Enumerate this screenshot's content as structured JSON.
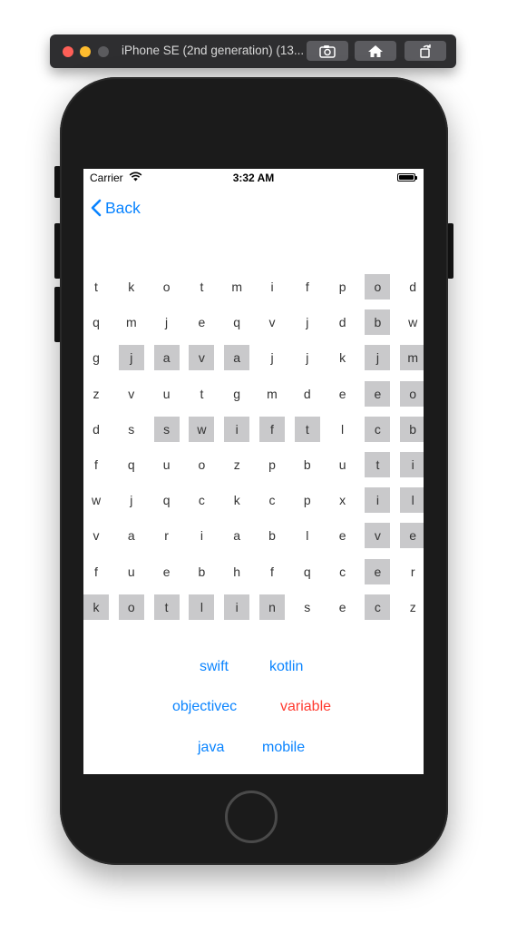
{
  "window": {
    "title": "iPhone SE (2nd generation) (13..."
  },
  "status_bar": {
    "carrier": "Carrier",
    "time": "3:32 AM"
  },
  "nav": {
    "back_label": "Back"
  },
  "grid": [
    [
      [
        "t",
        0
      ],
      [
        "k",
        0
      ],
      [
        "o",
        0
      ],
      [
        "t",
        0
      ],
      [
        "m",
        0
      ],
      [
        "i",
        0
      ],
      [
        "f",
        0
      ],
      [
        "p",
        0
      ],
      [
        "o",
        1
      ],
      [
        "d",
        0
      ]
    ],
    [
      [
        "q",
        0
      ],
      [
        "m",
        0
      ],
      [
        "j",
        0
      ],
      [
        "e",
        0
      ],
      [
        "q",
        0
      ],
      [
        "v",
        0
      ],
      [
        "j",
        0
      ],
      [
        "d",
        0
      ],
      [
        "b",
        1
      ],
      [
        "w",
        0
      ]
    ],
    [
      [
        "g",
        0
      ],
      [
        "j",
        1
      ],
      [
        "a",
        1
      ],
      [
        "v",
        1
      ],
      [
        "a",
        1
      ],
      [
        "j",
        0
      ],
      [
        "j",
        0
      ],
      [
        "k",
        0
      ],
      [
        "j",
        1
      ],
      [
        "m",
        1
      ]
    ],
    [
      [
        "z",
        0
      ],
      [
        "v",
        0
      ],
      [
        "u",
        0
      ],
      [
        "t",
        0
      ],
      [
        "g",
        0
      ],
      [
        "m",
        0
      ],
      [
        "d",
        0
      ],
      [
        "e",
        0
      ],
      [
        "e",
        1
      ],
      [
        "o",
        1
      ]
    ],
    [
      [
        "d",
        0
      ],
      [
        "s",
        0
      ],
      [
        "s",
        1
      ],
      [
        "w",
        1
      ],
      [
        "i",
        1
      ],
      [
        "f",
        1
      ],
      [
        "t",
        1
      ],
      [
        "l",
        0
      ],
      [
        "c",
        1
      ],
      [
        "b",
        1
      ]
    ],
    [
      [
        "f",
        0
      ],
      [
        "q",
        0
      ],
      [
        "u",
        0
      ],
      [
        "o",
        0
      ],
      [
        "z",
        0
      ],
      [
        "p",
        0
      ],
      [
        "b",
        0
      ],
      [
        "u",
        0
      ],
      [
        "t",
        1
      ],
      [
        "i",
        1
      ]
    ],
    [
      [
        "w",
        0
      ],
      [
        "j",
        0
      ],
      [
        "q",
        0
      ],
      [
        "c",
        0
      ],
      [
        "k",
        0
      ],
      [
        "c",
        0
      ],
      [
        "p",
        0
      ],
      [
        "x",
        0
      ],
      [
        "i",
        1
      ],
      [
        "l",
        1
      ]
    ],
    [
      [
        "v",
        0
      ],
      [
        "a",
        0
      ],
      [
        "r",
        0
      ],
      [
        "i",
        0
      ],
      [
        "a",
        0
      ],
      [
        "b",
        0
      ],
      [
        "l",
        0
      ],
      [
        "e",
        0
      ],
      [
        "v",
        1
      ],
      [
        "e",
        1
      ]
    ],
    [
      [
        "f",
        0
      ],
      [
        "u",
        0
      ],
      [
        "e",
        0
      ],
      [
        "b",
        0
      ],
      [
        "h",
        0
      ],
      [
        "f",
        0
      ],
      [
        "q",
        0
      ],
      [
        "c",
        0
      ],
      [
        "e",
        1
      ],
      [
        "r",
        0
      ]
    ],
    [
      [
        "k",
        1
      ],
      [
        "o",
        1
      ],
      [
        "t",
        1
      ],
      [
        "l",
        1
      ],
      [
        "i",
        1
      ],
      [
        "n",
        1
      ],
      [
        "s",
        0
      ],
      [
        "e",
        0
      ],
      [
        "c",
        1
      ],
      [
        "z",
        0
      ]
    ]
  ],
  "words": [
    {
      "label": "swift",
      "color": "#0a84ff"
    },
    {
      "label": "kotlin",
      "color": "#0a84ff"
    },
    {
      "label": "objectivec",
      "color": "#0a84ff"
    },
    {
      "label": "variable",
      "color": "#ff3b30"
    },
    {
      "label": "java",
      "color": "#0a84ff"
    },
    {
      "label": "mobile",
      "color": "#0a84ff"
    }
  ],
  "colors": {
    "accent": "#0a84ff",
    "highlight": "#c9c9cb",
    "error": "#ff3b30"
  }
}
